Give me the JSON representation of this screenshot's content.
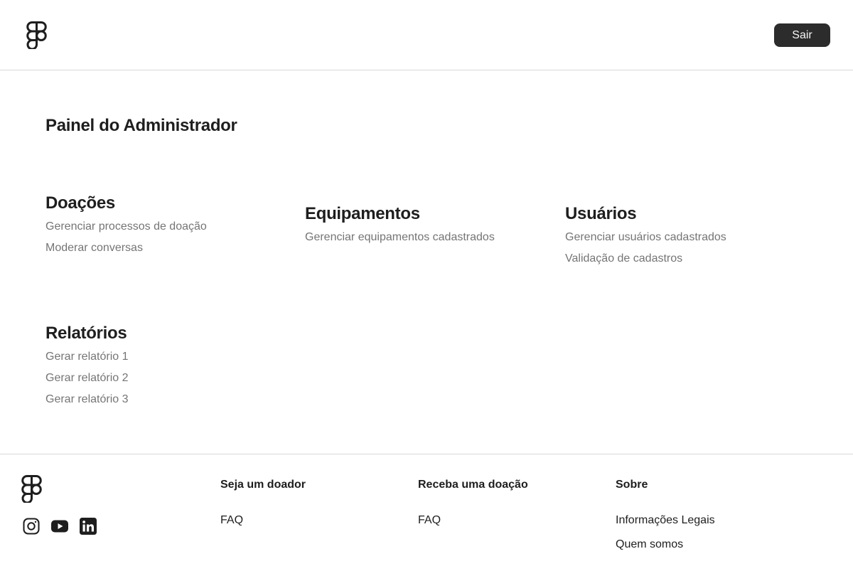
{
  "header": {
    "logo_icon": "figma-logo-icon",
    "logout_label": "Sair"
  },
  "main": {
    "title": "Painel do Administrador",
    "sections": [
      {
        "title": "Doações",
        "links": [
          "Gerenciar processos de doação",
          "Moderar conversas"
        ]
      },
      {
        "title": "Equipamentos",
        "links": [
          "Gerenciar equipamentos cadastrados"
        ]
      },
      {
        "title": "Usuários",
        "links": [
          "Gerenciar usuários cadastrados",
          "Validação de cadastros"
        ]
      },
      {
        "title": "Relatórios",
        "links": [
          "Gerar relatório 1",
          "Gerar relatório 2",
          "Gerar relatório 3"
        ]
      }
    ]
  },
  "footer": {
    "logo_icon": "figma-logo-icon",
    "social": [
      "instagram-icon",
      "youtube-icon",
      "linkedin-icon"
    ],
    "columns": [
      {
        "title": "Seja um doador",
        "links": [
          "FAQ"
        ]
      },
      {
        "title": "Receba uma doação",
        "links": [
          "FAQ"
        ]
      },
      {
        "title": "Sobre",
        "links": [
          "Informações Legais",
          "Quem somos"
        ]
      }
    ]
  },
  "colors": {
    "text_primary": "#1e1e1e",
    "text_secondary": "#757575",
    "button_bg": "#2c2c2c",
    "button_text": "#f5f5f5",
    "divider": "#d9d9d9"
  }
}
